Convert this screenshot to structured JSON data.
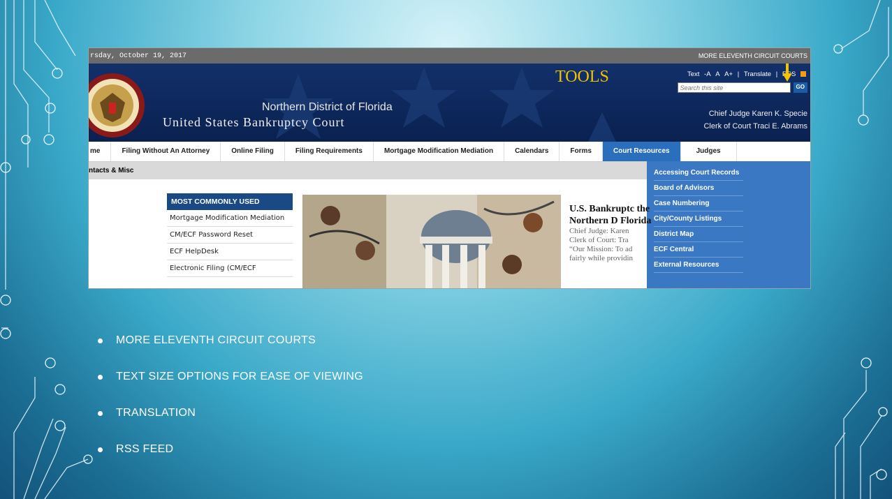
{
  "site": {
    "date": "rsday, October 19, 2017",
    "more_courts_link": "MORE ELEVENTH CIRCUIT COURTS",
    "tools_title": "TOOLS",
    "text_size_label": "Text",
    "text_minus": "-A",
    "text_normal": "A",
    "text_plus": "A+",
    "translate_link": "Translate",
    "rss_link": "RSS",
    "search_placeholder": "Search this site",
    "search_button": "GO",
    "court_name_line1": "Northern District of Florida",
    "court_name_line2": "United States Bankruptcy Court",
    "chief_judge": "Chief Judge Karen K. Specie",
    "clerk": "Clerk of Court Traci E. Abrams"
  },
  "nav": [
    "me",
    "Filing Without An Attorney",
    "Online Filing",
    "Filing Requirements",
    "Mortgage Modification Mediation",
    "Calendars",
    "Forms",
    "Court Resources",
    "Judges"
  ],
  "subnav": {
    "label": "ntacts & Misc"
  },
  "dropdown": [
    "Accessing Court Records",
    "Board of Advisors",
    "Case Numbering",
    "City/County Listings",
    "District Map",
    "ECF Central",
    "External Resources"
  ],
  "most_used": {
    "header": "MOST COMMONLY USED",
    "items": [
      "Mortgage Modification Mediation",
      "CM/ECF Password Reset",
      "ECF HelpDesk",
      "Electronic Filing (CM/ECF"
    ]
  },
  "welcome": {
    "heading": "U.S. Bankruptc the Northern D Florida",
    "lines": [
      "Chief Judge: Karen",
      "Clerk of Court: Tra",
      "“Our Mission: To ad",
      "fairly while providin"
    ]
  },
  "bullets": [
    "MORE ELEVENTH CIRCUIT COURTS",
    "TEXT SIZE OPTIONS FOR EASE OF VIEWING",
    "TRANSLATION",
    "RSS FEED"
  ],
  "colors": {
    "banner": "#0e2a5a",
    "nav_active": "#2a6fbb",
    "dropdown": "#3a78c4",
    "tools_gold": "#f2c200",
    "rss_orange": "#f59b1a"
  }
}
